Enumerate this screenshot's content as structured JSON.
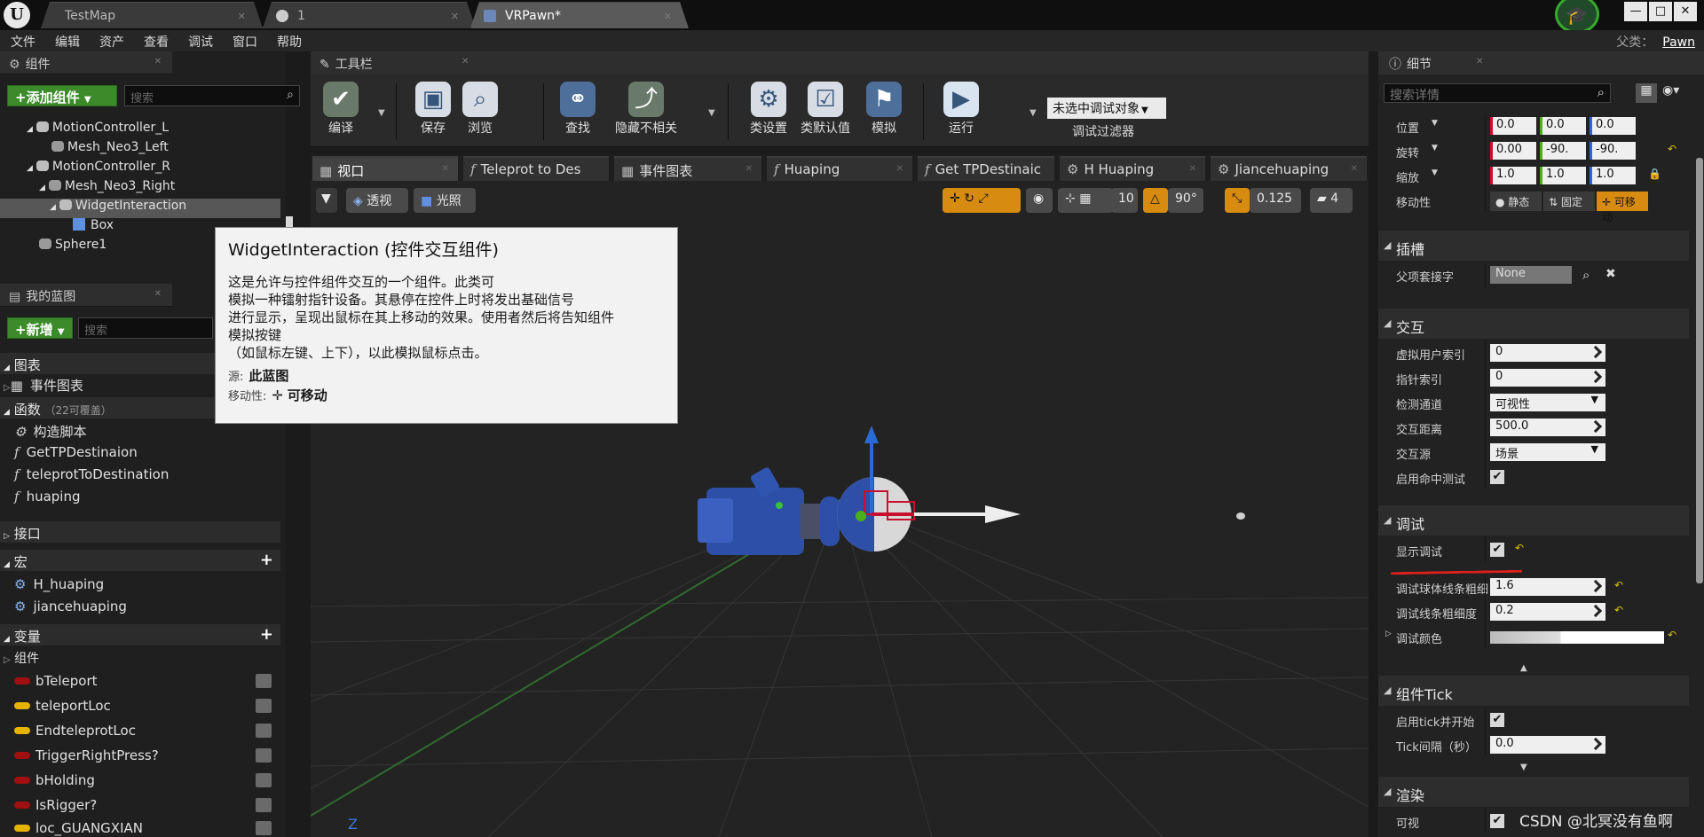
{
  "window": {
    "tabs": [
      {
        "label": "TestMap"
      },
      {
        "label": "1"
      },
      {
        "label": "VRPawn*"
      }
    ],
    "controls": {
      "minimize": "—",
      "maximize": "□",
      "close": "✕"
    }
  },
  "menu": {
    "items": [
      "文件",
      "编辑",
      "资产",
      "查看",
      "调试",
      "窗口",
      "帮助"
    ],
    "parent_label": "父类：",
    "parent_value": "Pawn"
  },
  "components_panel": {
    "title": "组件",
    "add_button": "+添加组件",
    "search_placeholder": "搜索",
    "tree": [
      {
        "label": "MotionController_L"
      },
      {
        "label": "Mesh_Neo3_Left"
      },
      {
        "label": "MotionController_R"
      },
      {
        "label": "Mesh_Neo3_Right"
      },
      {
        "label": "WidgetInteraction",
        "selected": true
      },
      {
        "label": "Box"
      },
      {
        "label": "Sphere1"
      }
    ]
  },
  "my_blueprint": {
    "title": "我的蓝图",
    "new_button": "+新增",
    "search_placeholder": "搜索",
    "sections": {
      "graphs": "图表",
      "event_graph": "事件图表",
      "functions": "函数",
      "functions_note": "（22可覆盖）",
      "interfaces": "接口",
      "macros": "宏",
      "variables": "变量",
      "components": "组件"
    },
    "functions": [
      "构造脚本",
      "GetTPDestinaion",
      "teleprotToDestination",
      "huaping"
    ],
    "macros": [
      "H_huaping",
      "jiancehuaping"
    ],
    "variables": [
      {
        "name": "bTeleport",
        "color": "#a01010"
      },
      {
        "name": "teleportLoc",
        "color": "#e6b400"
      },
      {
        "name": "EndteleprotLoc",
        "color": "#e6b400"
      },
      {
        "name": "TriggerRightPress?",
        "color": "#a01010"
      },
      {
        "name": "bHolding",
        "color": "#a01010"
      },
      {
        "name": "IsRigger?",
        "color": "#a01010"
      },
      {
        "name": "loc_GUANGXIAN",
        "color": "#e6b400"
      }
    ]
  },
  "toolbar": {
    "title": "工具栏",
    "buttons": {
      "compile": "编译",
      "save": "保存",
      "browse": "浏览",
      "find": "查找",
      "hide_unrelated": "隐藏不相关",
      "class_settings": "类设置",
      "class_defaults": "类默认值",
      "simulate": "模拟",
      "play": "运行"
    },
    "debug_select": "未选中调试对象",
    "debug_filter": "调试过滤器"
  },
  "editor_tabs": [
    {
      "label": "视口"
    },
    {
      "label": "Teleprot to Des"
    },
    {
      "label": "事件图表"
    },
    {
      "label": "Huaping"
    },
    {
      "label": "Get TPDestinaic"
    },
    {
      "label": "H Huaping"
    },
    {
      "label": "Jiancehuaping"
    }
  ],
  "viewport": {
    "perspective": "透视",
    "lit": "光照",
    "grid_snap": "10",
    "rotation_snap": "90°",
    "scale_snap": "0.125",
    "camera_speed": "4",
    "axis_label": "Z"
  },
  "tooltip": {
    "title": "WidgetInteraction (控件交互组件)",
    "lines": [
      "这是允许与控件组件交互的一个组件。此类可",
      "模拟一种镭射指针设备。其悬停在控件上时将发出基础信号",
      "进行显示，呈现出鼠标在其上移动的效果。使用者然后将告知组件",
      "模拟按键",
      "（如鼠标左键、上下），以此模拟鼠标点击。"
    ],
    "source_label": "源:",
    "source_value": "此蓝图",
    "mobility_label": "移动性:",
    "mobility_value": "可移动"
  },
  "details": {
    "title": "细节",
    "search_placeholder": "搜索详情",
    "transform": {
      "location_label": "位置",
      "location": [
        "0.0",
        "0.0",
        "0.0"
      ],
      "rotation_label": "旋转",
      "rotation": [
        "0.00",
        "-90.",
        "-90."
      ],
      "scale_label": "缩放",
      "scale": [
        "1.0",
        "1.0",
        "1.0"
      ],
      "mobility_label": "移动性",
      "mobility_options": [
        "静态",
        "固定",
        "可移动"
      ]
    },
    "sockets": {
      "title": "插槽",
      "parent_socket_label": "父项套接字",
      "parent_socket_value": "None"
    },
    "interaction": {
      "title": "交互",
      "virtual_user_index_label": "虚拟用户索引",
      "virtual_user_index": "0",
      "pointer_index_label": "指针索引",
      "pointer_index": "0",
      "trace_channel_label": "检测通道",
      "trace_channel": "可视性",
      "interaction_distance_label": "交互距离",
      "interaction_distance": "500.0",
      "interaction_source_label": "交互源",
      "interaction_source": "场景",
      "hit_testing_label": "启用命中测试"
    },
    "debug": {
      "title": "调试",
      "show_debug_label": "显示调试",
      "sphere_thickness_label": "调试球体线条粗细",
      "sphere_thickness": "1.6",
      "line_thickness_label": "调试线条粗细度",
      "line_thickness": "0.2",
      "color_label": "调试颜色"
    },
    "tick": {
      "title": "组件Tick",
      "start_with_tick_label": "启用tick并开始",
      "tick_interval_label": "Tick间隔（秒）",
      "tick_interval": "0.0"
    },
    "rendering": {
      "title": "渲染",
      "visible_label": "可视"
    }
  },
  "watermark": "CSDN @北冥没有鱼啊"
}
